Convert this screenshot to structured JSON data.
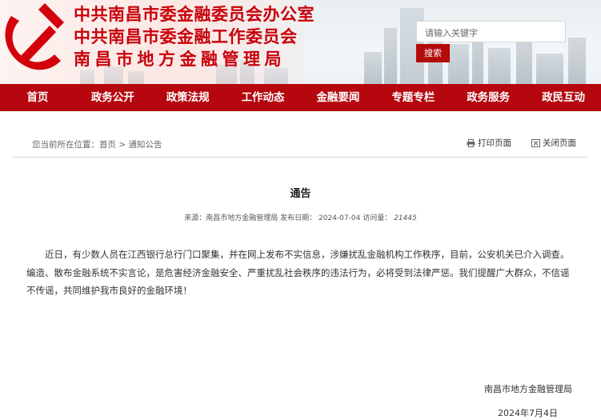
{
  "header": {
    "title_line1": "中共南昌市委金融委员会办公室",
    "title_line2": "中共南昌市委金融工作委员会",
    "title_line3": "南昌市地方金融管理局",
    "search_placeholder": "请输入关键字",
    "search_button": "搜索"
  },
  "nav": {
    "items": [
      "首页",
      "政务公开",
      "政策法规",
      "工作动态",
      "金融要闻",
      "专题专栏",
      "政务服务",
      "政民互动"
    ]
  },
  "breadcrumb": {
    "prefix": "您当前所在位置：",
    "home": "首页",
    "sep": " > ",
    "current": "通知公告"
  },
  "tools": {
    "print": "打印页面",
    "close": "关闭页面"
  },
  "article": {
    "title": "通告",
    "source_label": "来源：",
    "source": "南昌市地方金融管理局",
    "date_label": "发布日期：",
    "date": "2024-07-04",
    "hits_label": "访问量：",
    "hits": "21445",
    "body": "近日，有少数人员在江西银行总行门口聚集，并在网上发布不实信息，涉嫌扰乱金融机构工作秩序，目前，公安机关已介入调查。编造、散布金融系统不实言论，是危害经济金融安全、严重扰乱社会秩序的违法行为，必将受到法律严惩。我们提醒广大群众，不信谣不传谣，共同维护我市良好的金融环境！",
    "signature": "南昌市地方金融管理局",
    "sign_date": "2024年7月4日"
  },
  "colors": {
    "brand_red": "#b5070d",
    "title_red": "#c8000a"
  }
}
